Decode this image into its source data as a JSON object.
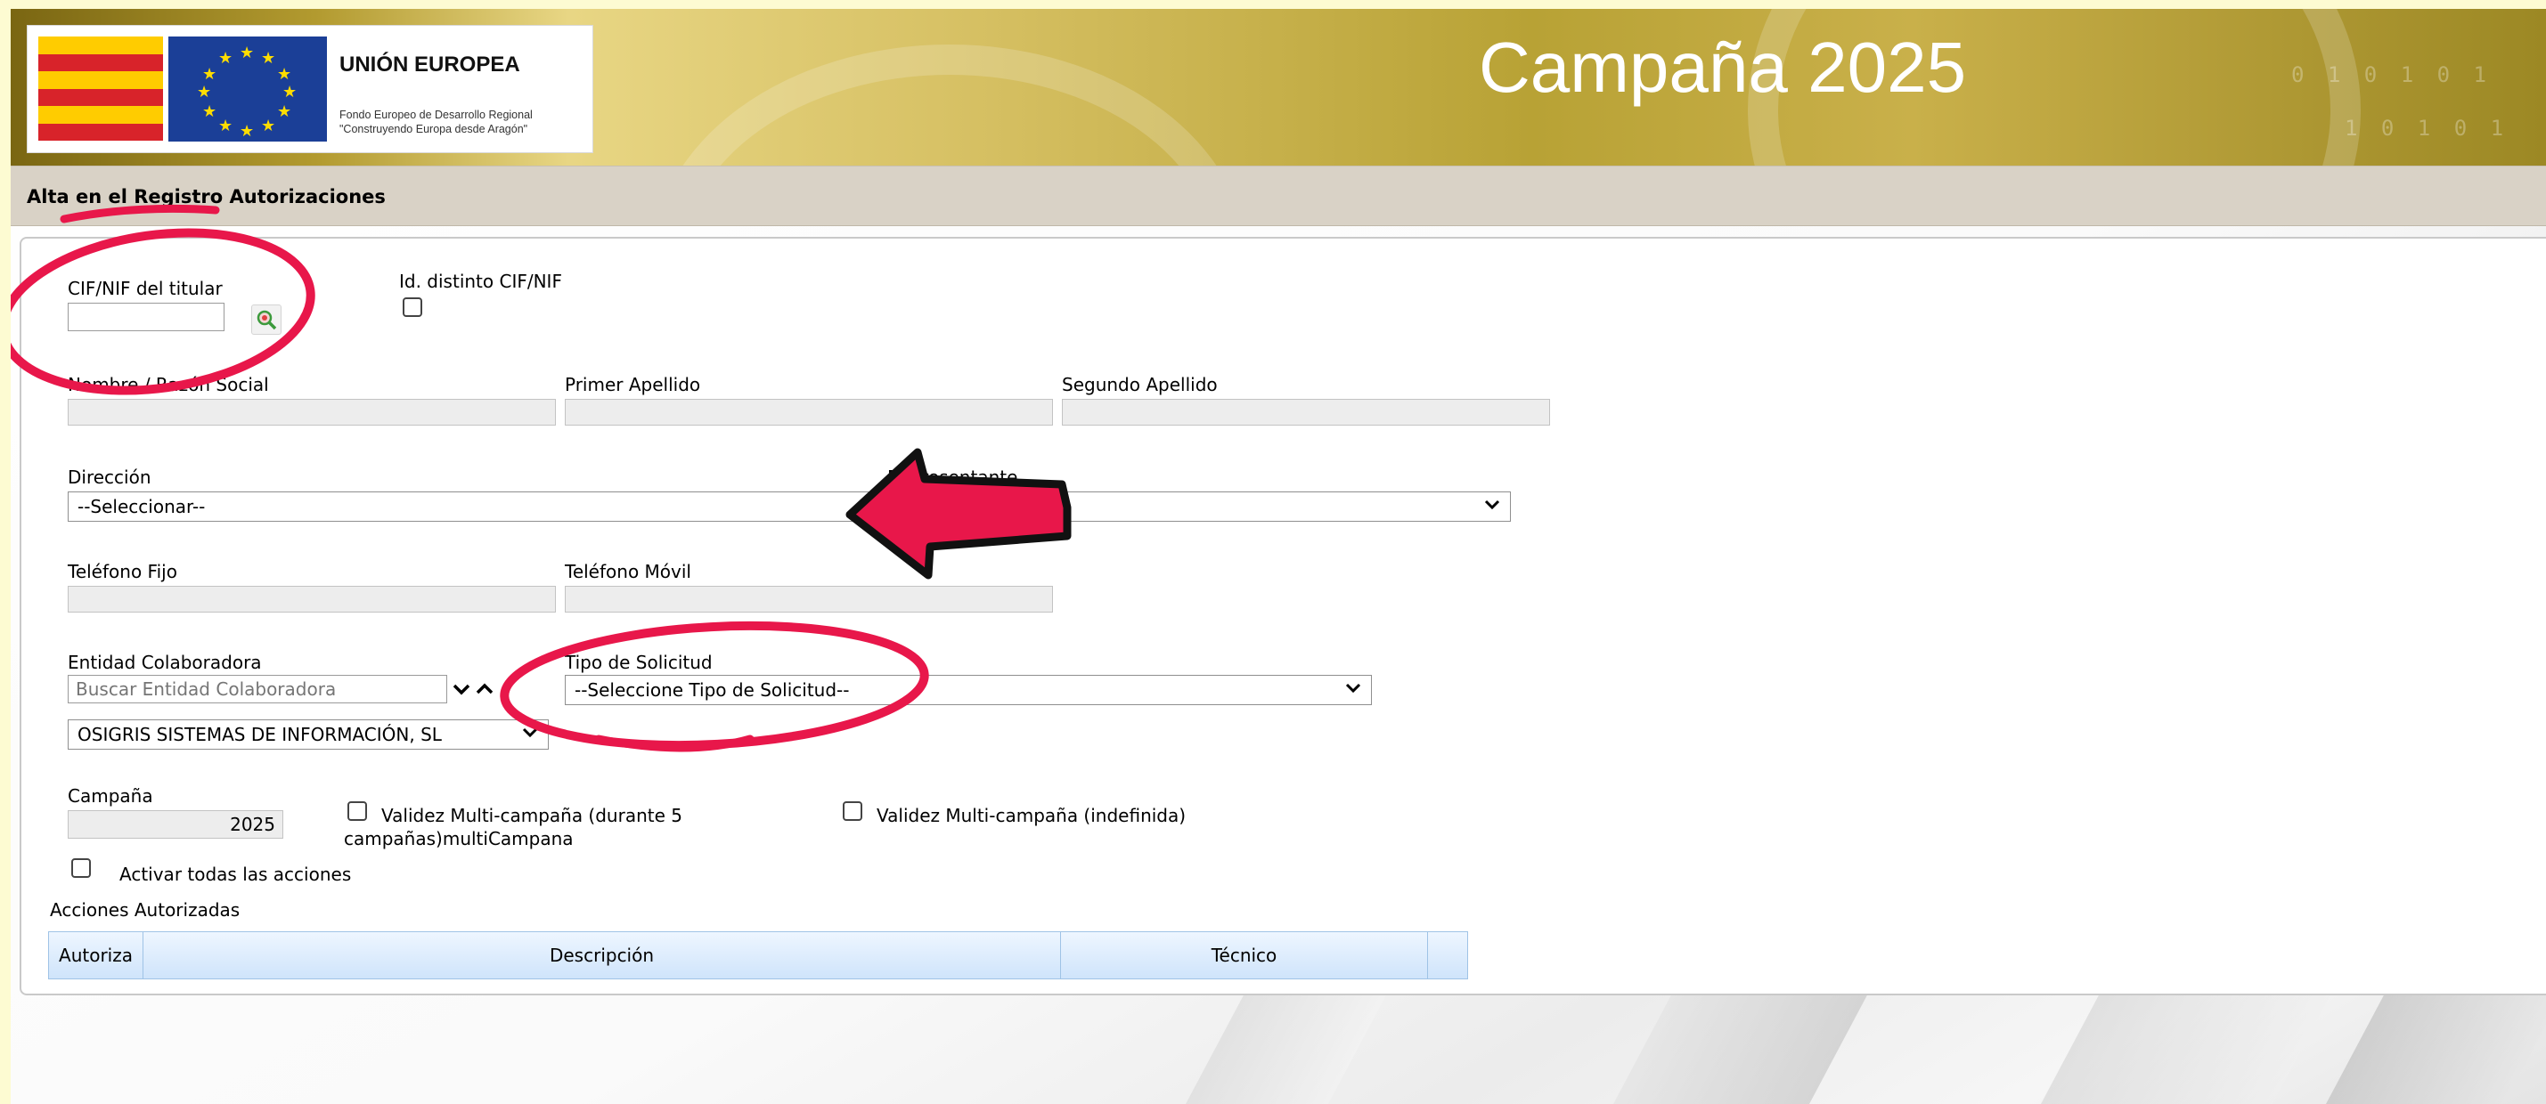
{
  "header": {
    "eu_title": "UNIÓN EUROPEA",
    "eu_subtitle_line1": "Fondo Europeo de Desarrollo Regional",
    "eu_subtitle_line2": "\"Construyendo Europa desde Aragón\"",
    "campaign_title": "Campaña 2025"
  },
  "page_title": "Alta en el Registro Autorizaciones",
  "form": {
    "cif_label": "CIF/NIF del titular",
    "cif_value": "",
    "id_distinto_label": "Id. distinto CIF/NIF",
    "nombre_label": "Nombre / Razón Social",
    "primer_apellido_label": "Primer Apellido",
    "segundo_apellido_label": "Segundo Apellido",
    "direccion_label": "Dirección",
    "direccion_value": "--Seleccionar--",
    "representante_label": "Representante",
    "representante_value": "",
    "telefono_fijo_label": "Teléfono Fijo",
    "telefono_movil_label": "Teléfono Móvil",
    "entidad_label": "Entidad Colaboradora",
    "entidad_placeholder": "Buscar Entidad Colaboradora",
    "entidad_value": "OSIGRIS SISTEMAS DE INFORMACIÓN, SL",
    "tipo_solicitud_label": "Tipo de Solicitud",
    "tipo_solicitud_value": "--Seleccione Tipo de Solicitud--",
    "campania_label": "Campaña",
    "campania_value": "2025",
    "multi5_label_line1": "Validez Multi-campaña (durante 5",
    "multi5_label_line2": "campañas)multiCampana",
    "multi_indef_label": "Validez Multi-campaña (indefinida)",
    "activar_label": "Activar todas las acciones",
    "acciones_label": "Acciones Autorizadas"
  },
  "table": {
    "columns": [
      "Autoriza",
      "Descripción",
      "Técnico"
    ]
  },
  "colors": {
    "annotation": "#e8174a",
    "header_gold": "#c9b04a",
    "table_header": "#cfe4fb"
  }
}
